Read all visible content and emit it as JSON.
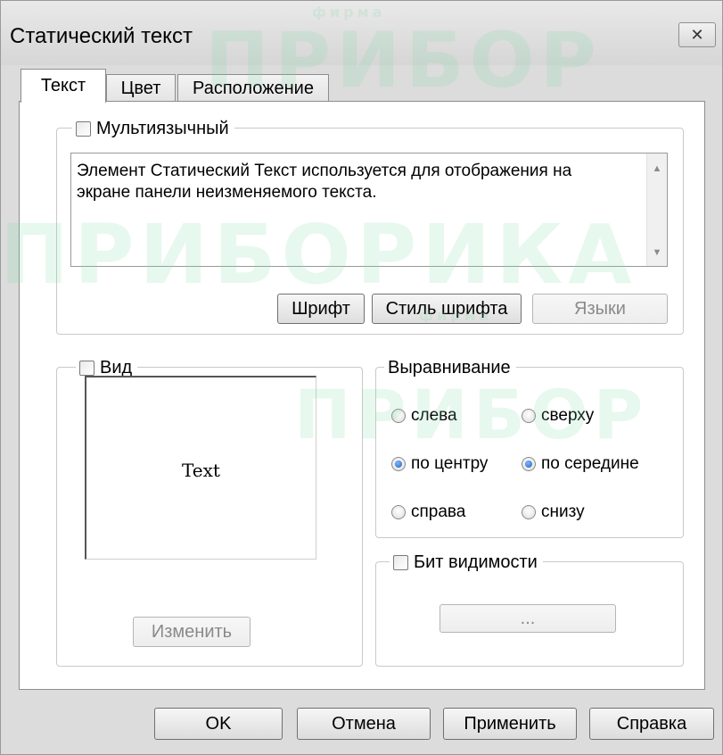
{
  "window": {
    "title": "Статический текст"
  },
  "tabs": [
    {
      "label": "Текст",
      "active": true
    },
    {
      "label": "Цвет",
      "active": false
    },
    {
      "label": "Расположение",
      "active": false
    }
  ],
  "multilang": {
    "label": "Мультиязычный",
    "checked": false,
    "text": "Элемент Статический Текст используется для отображения на экране панели неизменяемого текста."
  },
  "text_buttons": {
    "font": "Шрифт",
    "font_style": "Стиль шрифта",
    "languages": "Языки"
  },
  "view": {
    "label": "Вид",
    "checked": false,
    "preview_text": "Text",
    "change": "Изменить"
  },
  "alignment": {
    "label": "Выравнивание",
    "left": "слева",
    "center": "по центру",
    "right": "справа",
    "top": "сверху",
    "middle": "по середине",
    "bottom": "снизу",
    "horizontal_selected": "по центру",
    "vertical_selected": "по середине"
  },
  "visibility": {
    "label": "Бит видимости",
    "checked": false,
    "button": "..."
  },
  "dialog_buttons": {
    "ok": "OK",
    "cancel": "Отмена",
    "apply": "Применить",
    "help": "Справка"
  },
  "watermark": {
    "brand": "ПРИБОР",
    "brand2": "ПРИБОРИКА",
    "small": "фирма"
  },
  "colors": {
    "window_bg": "#dcdcdc",
    "radio_checked": "#1f5fb8",
    "watermark": "#78d7a0"
  }
}
